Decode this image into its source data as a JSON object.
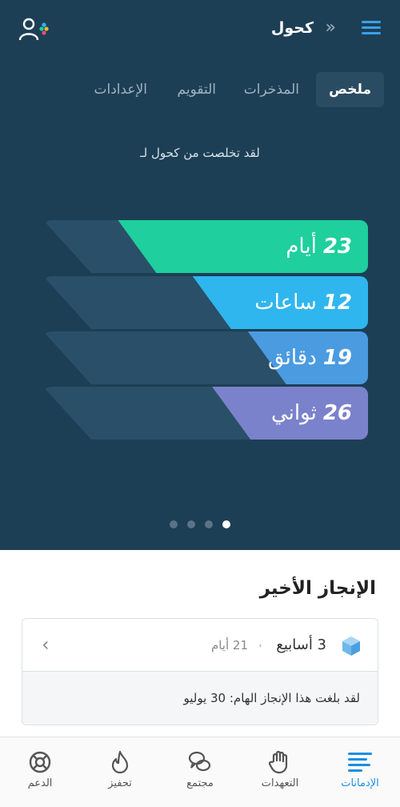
{
  "header": {
    "title": "كحول",
    "back_icon": "double-chevron-right-icon",
    "menu_icon": "hamburger-icon",
    "profile_icon": "user-add-icon"
  },
  "tabs": [
    {
      "label": "ملخص",
      "active": true
    },
    {
      "label": "المذخرات",
      "active": false
    },
    {
      "label": "التقويم",
      "active": false
    },
    {
      "label": "الإعدادات",
      "active": false
    }
  ],
  "subtitle": "لقد تخلصت من كحول لـ",
  "counters": [
    {
      "value": "23",
      "unit": "أيام",
      "color": "#1fcf9e",
      "fill": 0.77
    },
    {
      "value": "12",
      "unit": "ساعات",
      "color": "#2fb6ee",
      "fill": 0.54
    },
    {
      "value": "19",
      "unit": "دقائق",
      "color": "#4a9be0",
      "fill": 0.37
    },
    {
      "value": "26",
      "unit": "ثواني",
      "color": "#7b82cc",
      "fill": 0.48
    }
  ],
  "pager": {
    "count": 4,
    "active": 3
  },
  "achievement": {
    "section_title": "الإنجاز الأخير",
    "weeks": "3 أسابيع",
    "separator": "·",
    "days": "21 أيام",
    "message": "لقد بلغت هذا الإنجاز الهام: 30 يوليو"
  },
  "bottom_nav": [
    {
      "label": "الإدمانات",
      "icon": "bars-icon",
      "active": true
    },
    {
      "label": "التعهدات",
      "icon": "hand-icon",
      "active": false
    },
    {
      "label": "مجتمع",
      "icon": "chat-icon",
      "active": false
    },
    {
      "label": "تحفيز",
      "icon": "flame-icon",
      "active": false
    },
    {
      "label": "الدعم",
      "icon": "lifebuoy-icon",
      "active": false
    }
  ],
  "colors": {
    "hero_bg": "#1d3f55",
    "accent": "#1a8fe0"
  }
}
